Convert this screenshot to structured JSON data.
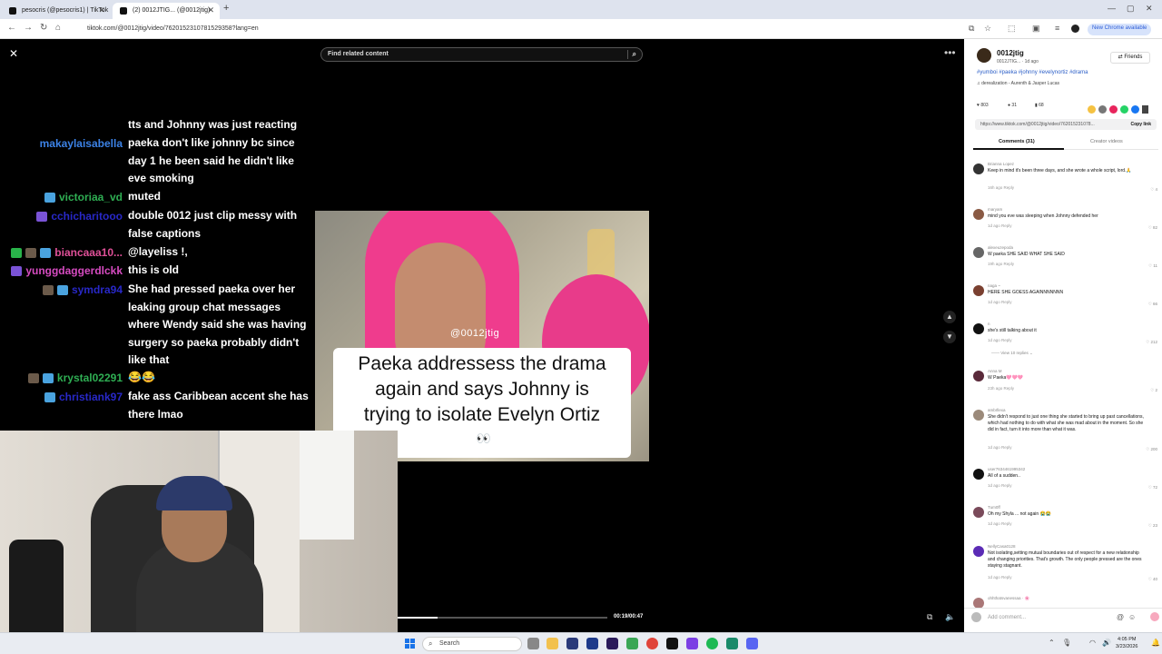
{
  "browser": {
    "tabs": [
      {
        "title": "pesocris (@pesocris1) | TikTok"
      },
      {
        "title": "(2) 0012JTIG... (@0012jtig)"
      }
    ],
    "new_tab": "+",
    "url": "tiktok.com/@0012jtig/video/7620152310781529358?lang=en",
    "chrome_available": "New Chrome available"
  },
  "player": {
    "search_placeholder": "Find related content",
    "time": "00:19/00:47",
    "progress": 0.19
  },
  "chat": [
    {
      "user": "",
      "text": "tts and Johnny was just reacting",
      "color": "#ffffff"
    },
    {
      "user": "makaylaisabella",
      "text": "paeka don't like johnny bc since day 1 he been said he didn't like eve smoking",
      "color": "#3c82e6"
    },
    {
      "user": "victoriaa_vd",
      "text": "muted",
      "color": "#2fae53"
    },
    {
      "user": "cchicharitooo",
      "text": "double 0012 just clip messy with false captions",
      "color": "#2828c8"
    },
    {
      "user": "biancaaa10...",
      "text": "@layeliss !,",
      "color": "#e05098"
    },
    {
      "user": "yunggdaggerdlckk",
      "text": "this is old",
      "color": "#d64bc1"
    },
    {
      "user": "symdra94",
      "text": "She had pressed paeka over her leaking group chat messages where Wendy said she was having surgery so paeka probably didn't like that",
      "color": "#2828c8"
    },
    {
      "user": "krystal02291",
      "text": "😂😂",
      "color": "#2fae53"
    },
    {
      "user": "christiank97",
      "text": "fake ass Caribbean accent she has there lmao",
      "color": "#2828c8"
    }
  ],
  "video": {
    "watermark": "@0012jtig",
    "caption_lines": [
      "Paeka addressess  the drama",
      "again and  says Johnny is",
      "trying to isolate Evelyn Ortiz"
    ],
    "emoji": "👀"
  },
  "panel": {
    "author": "0012jtig",
    "author_sub": "0012JTIG... · 1d ago",
    "friends_label": "Friends",
    "hashtags": "#yumboi #paeka #johnny #evelynortiz #drama",
    "music": "derealization - Aurenth & Jasper Lucas",
    "likes": "803",
    "comments": "31",
    "saves": "68",
    "link": "https://www.tiktok.com/@0012jtig/video/762015231078...",
    "copy_link": "Copy link",
    "tab_comments": "Comments (31)",
    "tab_creator": "Creator videos",
    "comment_list": [
      {
        "user": "Brianna Lopez",
        "text": "Keep in mind it's been three days, and she wrote a whole script, lord.🙏",
        "meta": "16h ago  Reply",
        "likes": "4"
      },
      {
        "user": "maryam",
        "text": "mind you eve was sleeping when Johnny defended her",
        "meta": "1d ago  Reply",
        "likes": "82"
      },
      {
        "user": "alexeuzepoda",
        "text": "W paeka SHE SAID WHAT SHE SAID",
        "meta": "19h ago  Reply",
        "likes": "11"
      },
      {
        "user": "naga ~",
        "text": "HERE SHE GOESS AGAINNNNNNN",
        "meta": "1d ago  Reply",
        "likes": "66"
      },
      {
        "user": "n",
        "text": "she's still talking about it",
        "meta": "1d ago  Reply",
        "likes": "212"
      },
      {
        "user": "Anna M",
        "text": "W Paeka🩷🩷🩷",
        "meta": "23h ago  Reply",
        "likes": "2"
      },
      {
        "user": "ambrllexa",
        "text": "She didn't respond to just one thing she started to bring up past cancellations, which had nothing to do with what she was mad about in the moment. So she did in fact, turn it into more than what it was.",
        "meta": "1d ago  Reply",
        "likes": "200"
      },
      {
        "user": "user7634461995342",
        "text": "All of a sudden..",
        "meta": "1d ago  Reply",
        "likes": "72"
      },
      {
        "user": "Tum0ff",
        "text": "Oh my Shyla ... not again 😭😭",
        "meta": "1d ago  Reply",
        "likes": "23"
      },
      {
        "user": "NellyCasa0128",
        "text": "Not isolating,setting mutual boundaries out of respect for a new relationship and changing priorities. That's growth. The only people pressed are the ones staying stagnant.",
        "meta": "1d ago  Reply",
        "likes": "40"
      },
      {
        "user": "ohhthatsvanessaa · 🌸",
        "text": "",
        "meta": "",
        "likes": ""
      }
    ],
    "view_replies": "View 10 replies ⌄",
    "add_comment": "Add comment..."
  },
  "taskbar": {
    "search": "Search",
    "time": "4:05 PM",
    "date": "3/23/2026"
  },
  "icons": [
    "close-icon",
    "search-icon",
    "more-icon",
    "heart-icon",
    "comment-icon",
    "bookmark-icon",
    "chevron-up-icon",
    "chevron-down-icon",
    "volume-icon",
    "windows-start-icon"
  ]
}
